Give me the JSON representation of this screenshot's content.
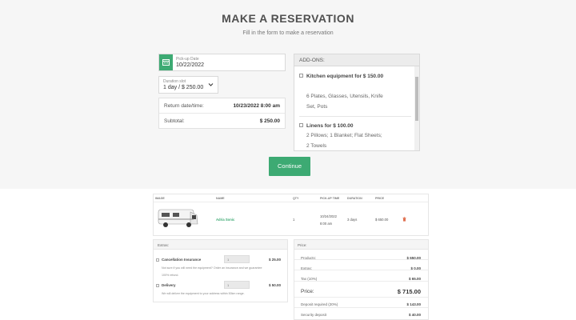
{
  "header": {
    "title": "MAKE A RESERVATION",
    "subtitle": "Fill in the form to make a reservation"
  },
  "form": {
    "pickup_label": "Pick-up Date",
    "pickup_value": "10/22/2022",
    "duration_label": "Duration slot",
    "duration_value": "1 day / $ 250.00",
    "return_label": "Return date/time:",
    "return_value": "10/23/2022 8:00 am",
    "subtotal_label": "Subtotal:",
    "subtotal_value": "$ 250.00",
    "continue_label": "Continue"
  },
  "addons": {
    "heading": "ADD-ONS:",
    "items": [
      {
        "name": "Kitchen equipment for $ 150.00",
        "desc": "6 Plates, Glasses, Utensils, Knife Set, Pots"
      },
      {
        "name": "Linens for $ 100.00",
        "desc": "2 Pillows; 1 Blanket; Flat Sheets; 2 Towels"
      }
    ]
  },
  "cart": {
    "columns": [
      "IMAGE",
      "NAME",
      "QTY",
      "PICK-UP TIME",
      "DURATION",
      "PRICE"
    ],
    "row": {
      "name": "Adria Sonic",
      "qty": "1",
      "pickup_date": "10/24/2022",
      "pickup_time": "8:00 am",
      "duration": "3 days",
      "price": "$ 650.00"
    }
  },
  "extras": {
    "heading": "Extras:",
    "items": [
      {
        "name": "Cancellation Insurance",
        "qty": "1",
        "price": "$ 25.00",
        "desc": "Not sure if you will need the equipment? Order an insurance and we guarantee 100% refund."
      },
      {
        "name": "Delivery",
        "qty": "1",
        "price": "$ 50.00",
        "desc": "We will deliver the equipment to your address within 50km range."
      }
    ]
  },
  "price": {
    "heading": "Price:",
    "rows": [
      {
        "label": "Products:",
        "value": "$ 650.00"
      },
      {
        "label": "Extras:",
        "value": "$ 0.00"
      },
      {
        "label": "Tax (10%)",
        "value": "$ 65.00"
      },
      {
        "label": "Price:",
        "value": "$ 715.00"
      },
      {
        "label": "Deposit required (20%)",
        "value": "$ 143.00"
      },
      {
        "label": "Security deposit",
        "value": "$ 40.00"
      }
    ]
  },
  "colors": {
    "accent": "#3daa73",
    "background_top": "#f6f6f6"
  },
  "icons": [
    "calendar-icon",
    "chevron-down-icon",
    "trash-icon",
    "motorhome-image"
  ]
}
